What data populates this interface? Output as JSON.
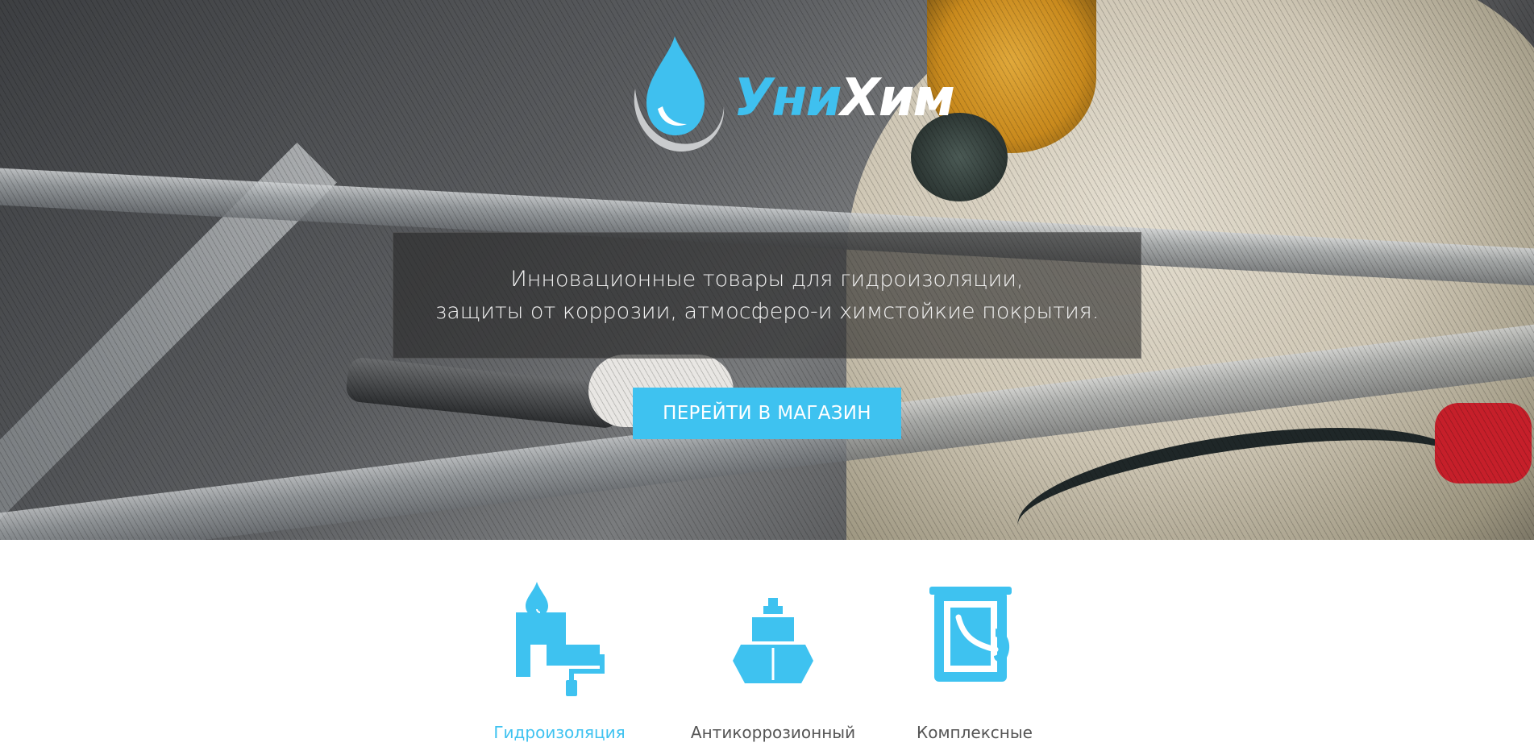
{
  "brand": {
    "name_part1": "Уни",
    "name_part2": "Хим",
    "accent_color": "#3ec2f0"
  },
  "hero": {
    "tagline_line1": "Инновационные товары для гидроизоляции,",
    "tagline_line2": "защиты от коррозии, атмосферо-и химстойкие покрытия.",
    "cta_label": "ПЕРЕЙТИ В МАГАЗИН"
  },
  "features": [
    {
      "label": "Гидроизоляция",
      "icon": "paint-roller-drop-icon",
      "active": true
    },
    {
      "label": "Антикоррозионный",
      "icon": "ship-icon",
      "active": false
    },
    {
      "label": "Комплексные",
      "icon": "paint-bucket-icon",
      "active": false
    }
  ]
}
